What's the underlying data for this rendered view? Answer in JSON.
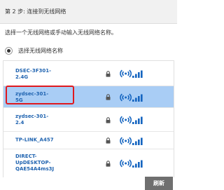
{
  "header": {
    "step_title": "第 2 步: 连接到无线网络"
  },
  "instruction": "选择一个无线网络或手动输入无线网络名称。",
  "option": {
    "label": "选择无线网络名称",
    "selected": true
  },
  "networks": [
    {
      "name_lines": [
        "DSEC-3F301-",
        "2.4G"
      ],
      "secured": true,
      "signal": "full",
      "selected": false
    },
    {
      "name_lines": [
        "zydsec-301-",
        "5G"
      ],
      "secured": true,
      "signal": "full",
      "selected": true
    },
    {
      "name_lines": [
        "zydsec-301-",
        "2.4"
      ],
      "secured": true,
      "signal": "full",
      "selected": false
    },
    {
      "name_lines": [
        "TP-LINK_A457"
      ],
      "secured": true,
      "signal": "full",
      "selected": false
    },
    {
      "name_lines": [
        "DIRECT-",
        "UpDESKTOP-",
        "QAE54A4ms3J"
      ],
      "secured": true,
      "signal": "full",
      "selected": false
    }
  ],
  "refresh_label": "刷新",
  "colors": {
    "selected_row": "#a9cdf5",
    "network_name": "#1f63b0",
    "highlight": "#e0191e",
    "signal": "#1565c0"
  }
}
